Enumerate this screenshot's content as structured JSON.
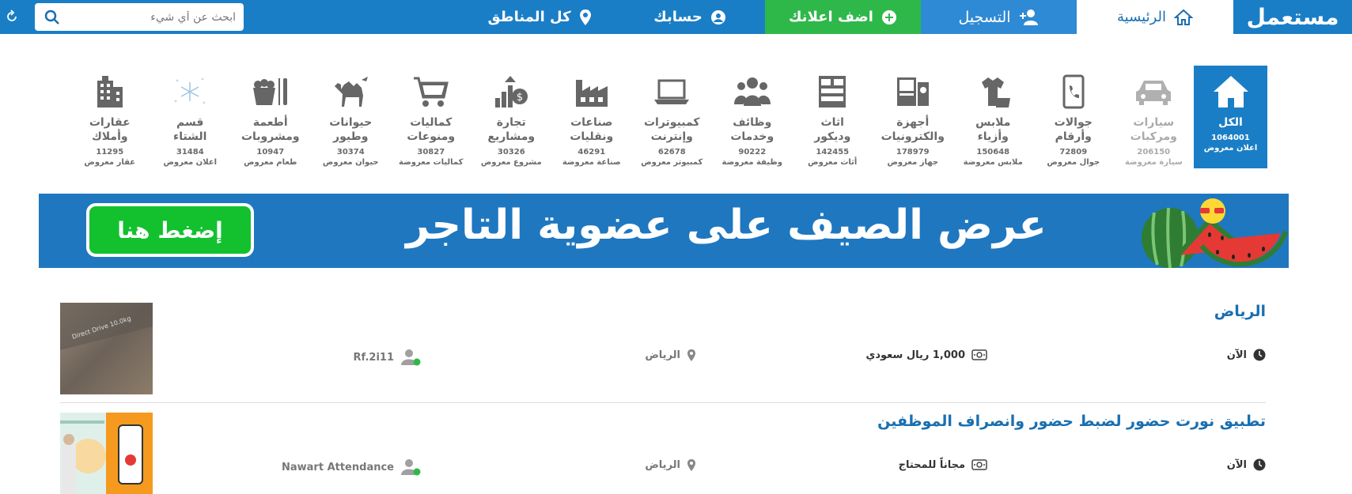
{
  "nav": {
    "logo": "مستعمل",
    "home": "الرئيسية",
    "register": "التسجيل",
    "add_ad": "اضف اعلانك",
    "account": "حسابك",
    "regions": "كل المناطق",
    "search_placeholder": "ابحث عن أي شيء"
  },
  "categories": [
    {
      "name1": "الكل",
      "name2": "",
      "count": "1064001",
      "label": "اعلان معروض",
      "icon": "home-icon"
    },
    {
      "name1": "سيارات",
      "name2": "ومركبات",
      "count": "206150",
      "label": "سيارة معروضة",
      "icon": "car-icon"
    },
    {
      "name1": "جوالات",
      "name2": "وأرقام",
      "count": "72809",
      "label": "جوال معروض",
      "icon": "phone-icon"
    },
    {
      "name1": "ملابس",
      "name2": "وأزياء",
      "count": "150648",
      "label": "ملابس معروضة",
      "icon": "clothes-icon"
    },
    {
      "name1": "أجهزة",
      "name2": "والكترونيات",
      "count": "178979",
      "label": "جهاز معروض",
      "icon": "appliance-icon"
    },
    {
      "name1": "اثاث",
      "name2": "وديكور",
      "count": "142455",
      "label": "أثاث معروض",
      "icon": "furniture-icon"
    },
    {
      "name1": "وظائف",
      "name2": "وخدمات",
      "count": "90222",
      "label": "وظيفة معروضة",
      "icon": "people-icon"
    },
    {
      "name1": "كمبيوترات",
      "name2": "وإنترنت",
      "count": "62678",
      "label": "كمبيوتر معروض",
      "icon": "laptop-icon"
    },
    {
      "name1": "صناعات",
      "name2": "ونقليات",
      "count": "46291",
      "label": "صناعة معروضة",
      "icon": "factory-icon"
    },
    {
      "name1": "تجارة",
      "name2": "ومشاريع",
      "count": "30326",
      "label": "مشروع معروض",
      "icon": "trade-icon"
    },
    {
      "name1": "كماليات",
      "name2": "ومنوعات",
      "count": "30827",
      "label": "كماليات معروضة",
      "icon": "cart-icon"
    },
    {
      "name1": "حيوانات",
      "name2": "وطيور",
      "count": "30374",
      "label": "حيوان معروض",
      "icon": "camel-icon"
    },
    {
      "name1": "أطعمة",
      "name2": "ومشروبات",
      "count": "10947",
      "label": "طعام معروض",
      "icon": "food-icon"
    },
    {
      "name1": "قسم",
      "name2": "الشتاء",
      "count": "31484",
      "label": "اعلان معروض",
      "icon": "snow-icon"
    },
    {
      "name1": "عقارات",
      "name2": "وأملاك",
      "count": "11295",
      "label": "عقار معروض",
      "icon": "building-icon"
    }
  ],
  "banner": {
    "text": "عرض الصيف على عضوية التاجر",
    "button": "إضغط هنا"
  },
  "listings": [
    {
      "title": "الرياض",
      "time": "الآن",
      "price": "1,000 ريال سعودي",
      "city": "الرياض",
      "user": "Rf.2i11"
    },
    {
      "title": "تطبيق نورت حضور لضبط حضور وانصراف الموظفين",
      "time": "الآن",
      "price": "مجاناً للمحتاج",
      "city": "الرياض",
      "user": "Nawart Attendance"
    }
  ],
  "thumb1_text": "Direct Drive 10.0kg"
}
